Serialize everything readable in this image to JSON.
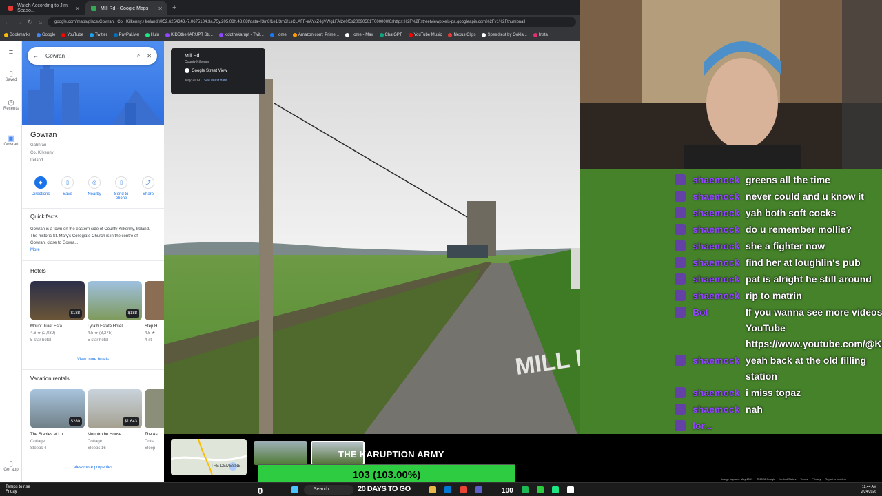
{
  "browser": {
    "tabs": [
      {
        "label": "Watch According to Jim Seaso..."
      },
      {
        "label": "Mill Rd - Google Maps"
      }
    ],
    "url": "google.com/maps/place/Gowran,+Co.+Kilkenny,+Ireland/@52.6254343,-7.0675184,3a,75y,205.08h,48.08t/data=!3m8!1e1!3m6!1sCLAFF-eAYxZ-lgVWgLFAl2e0!5s20090501T000000!6shttps:%2F%2Fstreetviewpixels-pa.googleapis.com%2Fv1%2Fthumbnail",
    "bookmarks": [
      {
        "label": "Bookmarks",
        "color": "#fbbc04"
      },
      {
        "label": "Google",
        "color": "#4285f4"
      },
      {
        "label": "YouTube",
        "color": "#ff0000"
      },
      {
        "label": "Twitter",
        "color": "#1da1f2"
      },
      {
        "label": "PayPal.Me",
        "color": "#0070ba"
      },
      {
        "label": "Hulu",
        "color": "#1ce783"
      },
      {
        "label": "KIDDtheKARUPT Str...",
        "color": "#9146ff"
      },
      {
        "label": "kiddthekarupt - Twit...",
        "color": "#9146ff"
      },
      {
        "label": "Home",
        "color": "#1877f2"
      },
      {
        "label": "Amazon.com: Prime...",
        "color": "#ff9900"
      },
      {
        "label": "Home - Max",
        "color": "#ffffff"
      },
      {
        "label": "ChatGPT",
        "color": "#10a37f"
      },
      {
        "label": "YouTube Music",
        "color": "#ff0000"
      },
      {
        "label": "Nexus Clips",
        "color": "#e53935"
      },
      {
        "label": "Speedtest by Ookla...",
        "color": "#ffffff"
      },
      {
        "label": "Insta",
        "color": "#e1306c"
      }
    ]
  },
  "rail": {
    "items": [
      {
        "label": "Saved",
        "icon": "bookmark-icon",
        "glyph": "▯"
      },
      {
        "label": "Recents",
        "icon": "history-icon",
        "glyph": "◷"
      },
      {
        "label": "Gowran",
        "icon": "place-thumb-icon",
        "glyph": "▣"
      },
      {
        "label": "Get app",
        "icon": "phone-icon",
        "glyph": "▯"
      }
    ]
  },
  "search": {
    "value": "Gowran"
  },
  "place": {
    "title": "Gowran",
    "irish": "Gabhran",
    "county": "Co. Kilkenny",
    "country": "Ireland"
  },
  "actions": [
    {
      "label": "Directions",
      "icon": "directions-icon",
      "glyph": "◆"
    },
    {
      "label": "Save",
      "icon": "save-icon",
      "glyph": "▯"
    },
    {
      "label": "Nearby",
      "icon": "nearby-icon",
      "glyph": "◎"
    },
    {
      "label": "Send to phone",
      "icon": "send-to-phone-icon",
      "glyph": "▯"
    },
    {
      "label": "Share",
      "icon": "share-icon",
      "glyph": "⤴"
    }
  ],
  "facts": {
    "heading": "Quick facts",
    "text": "Gowran is a town on the eastern side of County Kilkenny, Ireland. The historic St. Mary's Collegiate Church is in the centre of Gowran, close to Gowra...",
    "more": "More"
  },
  "hotels": {
    "heading": "Hotels",
    "items": [
      {
        "name": "Mount Juliet Esta...",
        "price": "$188",
        "rating": "4.6 ★ (2,039)",
        "cls": "5-star hotel",
        "color": "#3b3a55"
      },
      {
        "name": "Lyrath Estate Hotel",
        "price": "$188",
        "rating": "4.5 ★ (3,275)",
        "cls": "5-star hotel",
        "color": "#7e9a5a"
      },
      {
        "name": "Step H...",
        "price": "",
        "rating": "4.5 ★",
        "cls": "4-st",
        "color": "#8a6d52"
      }
    ],
    "more": "View more hotels"
  },
  "rentals": {
    "heading": "Vacation rentals",
    "items": [
      {
        "name": "The Stables at Lo...",
        "price": "$280",
        "type": "Cottage",
        "sleeps": "Sleeps 4",
        "color": "#6f7f86"
      },
      {
        "name": "Mountrothe House",
        "price": "$1,643",
        "type": "Cottage",
        "sleeps": "Sleeps 16",
        "color": "#a4a090"
      },
      {
        "name": "The As...",
        "price": "",
        "type": "Cotta",
        "sleeps": "Sleep",
        "color": "#8b8f7a"
      }
    ],
    "more": "View more properties"
  },
  "streetview": {
    "road": "Mill Rd",
    "county": "County Kilkenny",
    "source": "Google Street View",
    "date": "May 2009",
    "latest": "See latest date",
    "paint": "MILL RD"
  },
  "chat": [
    {
      "user": "shaemock",
      "text": "greens all the time"
    },
    {
      "user": "shaemock",
      "text": "never could and u know it"
    },
    {
      "user": "shaemock",
      "text": "yah both soft cocks"
    },
    {
      "user": "shaemock",
      "text": "do u remember mollie?"
    },
    {
      "user": "shaemock",
      "text": "she a fighter now"
    },
    {
      "user": "shaemock",
      "text": "find her at loughlin's pub"
    },
    {
      "user": "shaemock",
      "text": "pat is alright he still around"
    },
    {
      "user": "shaemock",
      "text": "rip to matrin"
    },
    {
      "user": "Bot",
      "text": "If you wanna see more videos go on my YouTube https://www.youtube.com/@KIDDtheKARUPT"
    },
    {
      "user": "shaemock",
      "text": "yeah back at the old filling station"
    },
    {
      "user": "shaemock",
      "text": "i miss topaz"
    },
    {
      "user": "shaemock",
      "text": "nah"
    },
    {
      "user": "lor...",
      "text": ""
    }
  ],
  "overlay": {
    "army": "THE KARUPTION ARMY",
    "progress_label": "103 (103.00%)",
    "progress": 1.0,
    "map_label": "THE DEMESNE"
  },
  "footer": {
    "items": [
      "Image capture: May 2009",
      "© 2026 Google",
      "United States",
      "Terms",
      "Privacy",
      "Report a problem"
    ]
  },
  "taskbar": {
    "weather": "Temps to rise",
    "weather_sub": "Friday",
    "search": "Search",
    "countdown": "20 DAYS TO GO",
    "zero": "0",
    "hundred": "100",
    "time": "12:44 AM",
    "date": "2/24/2026"
  }
}
